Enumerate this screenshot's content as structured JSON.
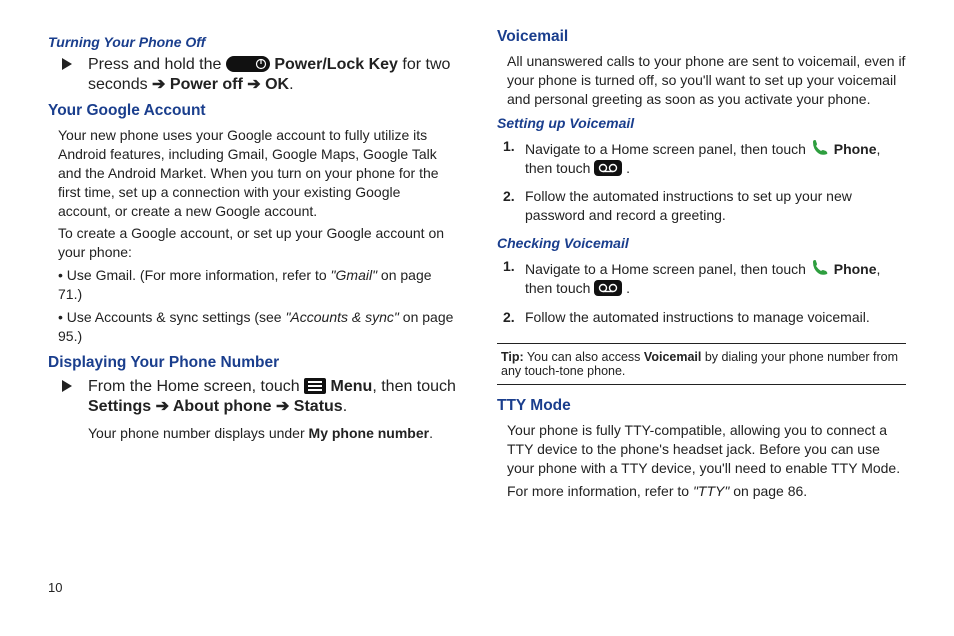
{
  "pagenumber": "10",
  "left": {
    "h3_off": "Turning Your Phone Off",
    "off_step_pre": "Press and hold the ",
    "off_step_mid": " Power/Lock Key",
    "off_step_post": " for two seconds",
    "off_step_poweroff": "Power off",
    "off_step_ok": "OK",
    "h2_google": "Your Google Account",
    "google_p1": "Your new phone uses your Google account to fully utilize its Android features, including Gmail, Google Maps, Google Talk and the Android Market. When you turn on your phone for the first time, set up a connection with your existing Google account, or create a new Google account.",
    "google_p2": "To create a Google account, or set up your Google account on your phone:",
    "google_b1_pre": "Use Gmail. (For more information, refer to ",
    "google_b1_ref": "\"Gmail\"",
    "google_b1_post": " on page 71.)",
    "google_b2_pre": "Use Accounts & sync settings (see ",
    "google_b2_ref": "\"Accounts & sync\"",
    "google_b2_post": " on page 95.)",
    "h2_display": "Displaying Your Phone Number",
    "disp_pre": "From the Home screen, touch ",
    "disp_menu": " Menu",
    "disp_mid": ", then touch ",
    "disp_settings": "Settings",
    "disp_about": "About phone",
    "disp_status": "Status",
    "disp_p2_pre": "Your phone number displays under ",
    "disp_p2_b": "My phone number",
    "disp_p2_post": "."
  },
  "right": {
    "h2_vm": "Voicemail",
    "vm_p1": "All unanswered calls to your phone are sent to voicemail, even if your phone is turned off, so you'll want to set up your voicemail and personal greeting as soon as you activate your phone.",
    "h3_setup": "Setting up Voicemail",
    "s1_pre": "Navigate to a Home screen panel, then touch ",
    "s1_phone": " Phone",
    "s1_mid": ", then touch ",
    "s2": "Follow the automated instructions to set up your new password and record a greeting.",
    "h3_check": "Checking Voicemail",
    "c1_pre": "Navigate to a Home screen panel, then touch ",
    "c1_phone": " Phone",
    "c1_mid": ", then touch ",
    "c2": "Follow the automated instructions to manage voicemail.",
    "tip_label": "Tip:",
    "tip_pre": " You can also access ",
    "tip_b": "Voicemail",
    "tip_post": " by dialing your phone number from any touch-tone phone.",
    "h2_tty": "TTY Mode",
    "tty_p1": "Your phone is fully TTY-compatible, allowing you to connect a TTY device to the phone's headset jack. Before you can use your phone with a TTY device, you'll need to enable TTY Mode.",
    "tty_p2_pre": "For more information, refer to ",
    "tty_p2_ref": "\"TTY\"",
    "tty_p2_post": " on page 86."
  },
  "ol": {
    "n1": "1.",
    "n2": "2."
  }
}
